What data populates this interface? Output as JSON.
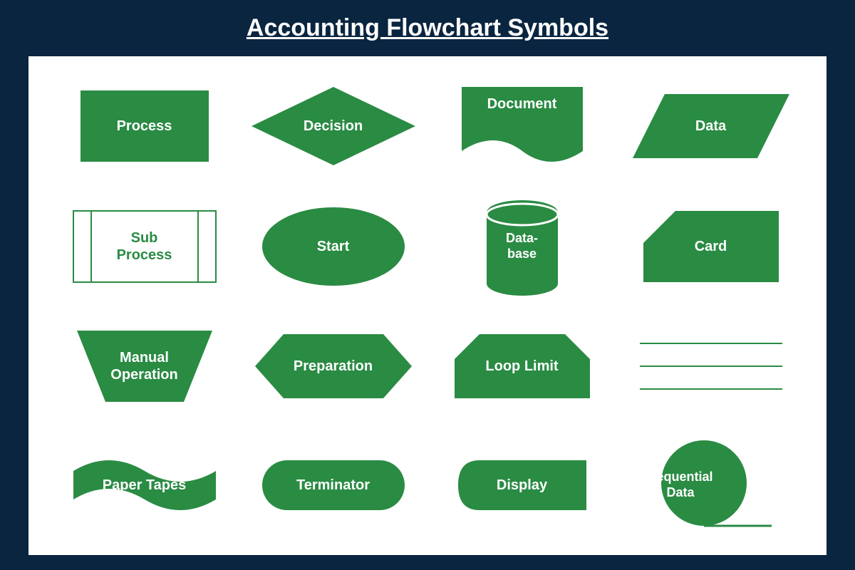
{
  "title": "Accounting Flowchart Symbols",
  "colors": {
    "bg": "#0a2540",
    "shape": "#2a8b43",
    "text": "#ffffff"
  },
  "symbols": [
    {
      "id": "process",
      "label": "Process"
    },
    {
      "id": "decision",
      "label": "Decision"
    },
    {
      "id": "document",
      "label": "Document"
    },
    {
      "id": "data",
      "label": "Data"
    },
    {
      "id": "subprocess",
      "label": "Sub\nProcess"
    },
    {
      "id": "start",
      "label": "Start"
    },
    {
      "id": "database",
      "label": "Data-\nbase"
    },
    {
      "id": "card",
      "label": "Card"
    },
    {
      "id": "manual-operation",
      "label": "Manual\nOperation"
    },
    {
      "id": "preparation",
      "label": "Preparation"
    },
    {
      "id": "loop-limit",
      "label": "Loop Limit"
    },
    {
      "id": "lines",
      "label": ""
    },
    {
      "id": "paper-tapes",
      "label": "Paper Tapes"
    },
    {
      "id": "terminator",
      "label": "Terminator"
    },
    {
      "id": "display",
      "label": "Display"
    },
    {
      "id": "sequential-data",
      "label": "Sequential\nData"
    }
  ]
}
